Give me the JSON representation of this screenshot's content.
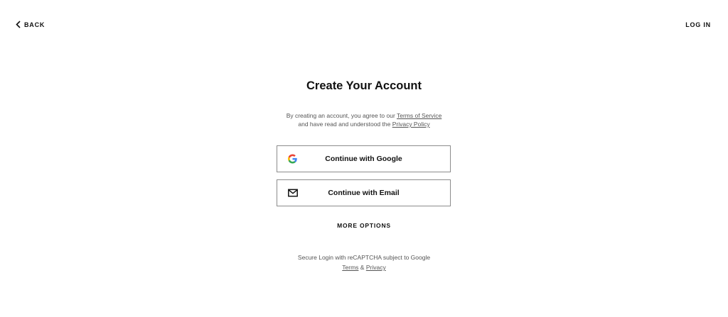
{
  "header": {
    "back_label": "BACK",
    "login_label": "LOG IN"
  },
  "main": {
    "title": "Create Your Account",
    "legal": {
      "line1_prefix": "By creating an account, you agree to our ",
      "terms_link": "Terms of Service",
      "line2_prefix": "and have read and understood the ",
      "privacy_link": "Privacy Policy"
    },
    "buttons": [
      {
        "label": "Continue with Google",
        "icon": "google-icon"
      },
      {
        "label": "Continue with Email",
        "icon": "envelope-icon"
      }
    ],
    "more_options_label": "MORE OPTIONS",
    "recaptcha": {
      "line1": "Secure Login with reCAPTCHA subject to Google",
      "terms_link": "Terms",
      "separator": " & ",
      "privacy_link": "Privacy"
    }
  },
  "colors": {
    "text": "#111111",
    "muted_text": "#555555",
    "button_border": "#8c8c8c",
    "google_blue": "#4285F4",
    "google_red": "#EA4335",
    "google_yellow": "#FBBC05",
    "google_green": "#34A853"
  }
}
